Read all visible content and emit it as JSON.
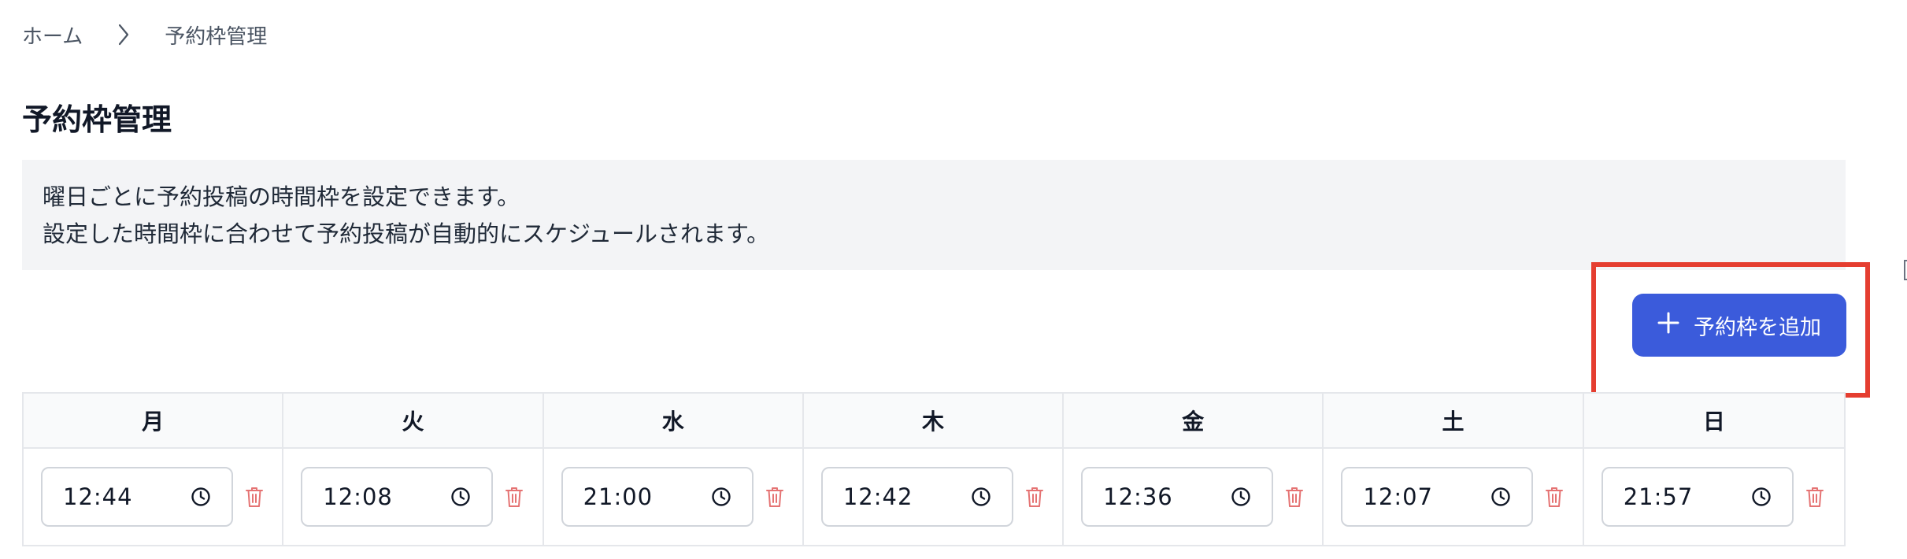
{
  "breadcrumb": {
    "home": "ホーム",
    "current": "予約枠管理"
  },
  "page": {
    "title": "予約枠管理",
    "description_line1": "曜日ごとに予約投稿の時間枠を設定できます。",
    "description_line2": "設定した時間枠に合わせて予約投稿が自動的にスケジュールされます。"
  },
  "actions": {
    "add_slot_label": "予約枠を追加"
  },
  "schedule": {
    "days": [
      {
        "label": "月",
        "time": "12:44"
      },
      {
        "label": "火",
        "time": "12:08"
      },
      {
        "label": "水",
        "time": "21:00"
      },
      {
        "label": "木",
        "time": "12:42"
      },
      {
        "label": "金",
        "time": "12:36"
      },
      {
        "label": "土",
        "time": "12:07"
      },
      {
        "label": "日",
        "time": "21:57"
      }
    ]
  },
  "icons": {
    "separator": "chevron-right-icon",
    "add": "plus-icon",
    "time": "clock-icon",
    "delete": "trash-icon"
  },
  "colors": {
    "primary": "#3b5bdb",
    "highlight": "#e53e30",
    "delete": "#e57373",
    "info_bg": "#f3f4f6",
    "header_bg": "#f9fafb"
  }
}
